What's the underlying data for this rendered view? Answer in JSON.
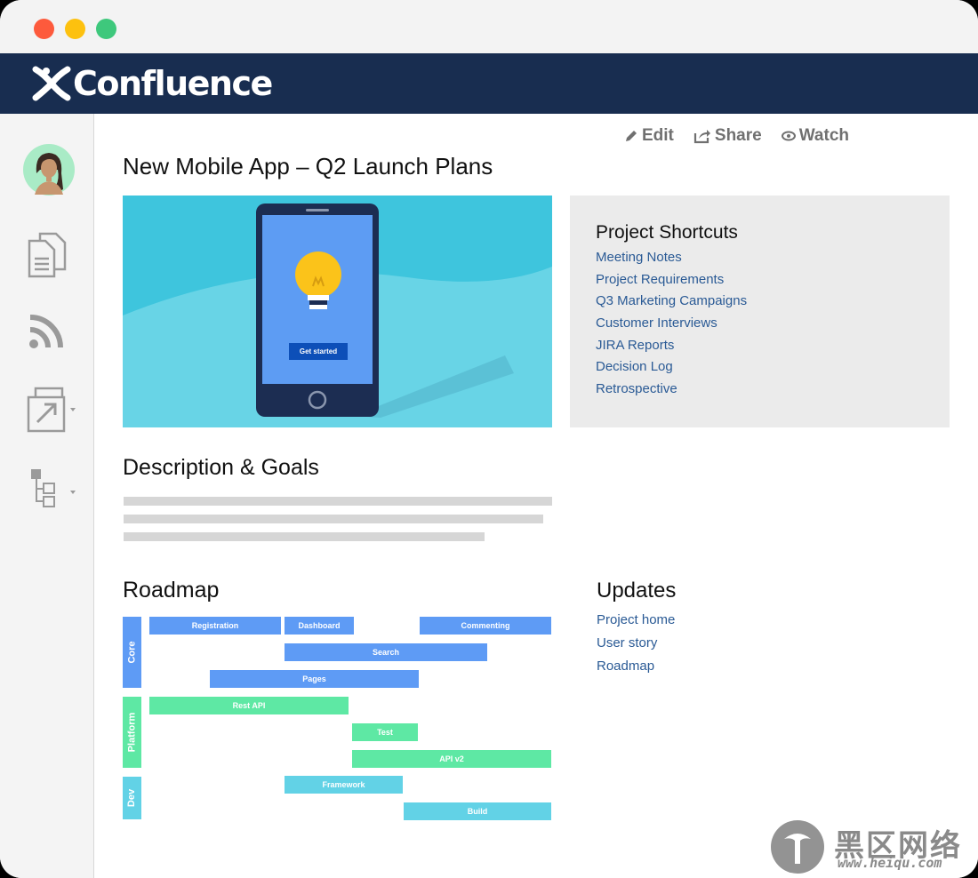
{
  "window": {
    "controls": [
      "close",
      "minimize",
      "maximize"
    ],
    "colors": {
      "close": "#fd5a3c",
      "minimize": "#fdc10f",
      "maximize": "#3ec87c"
    }
  },
  "header": {
    "app_name": "Confluence",
    "brand_color": "#182d50"
  },
  "sidebar": {
    "items": [
      {
        "name": "avatar",
        "icon": "user-avatar-icon"
      },
      {
        "name": "pages",
        "icon": "document-icon"
      },
      {
        "name": "feed",
        "icon": "rss-icon"
      },
      {
        "name": "shared",
        "icon": "share-link-icon"
      },
      {
        "name": "tree",
        "icon": "page-tree-icon"
      }
    ]
  },
  "toolbar": {
    "edit_label": "Edit",
    "share_label": "Share",
    "watch_label": "Watch"
  },
  "page": {
    "title": "New Mobile App – Q2 Launch Plans",
    "hero": {
      "button_label": "Get started"
    },
    "description_heading": "Description & Goals",
    "roadmap_heading": "Roadmap",
    "updates_heading": "Updates"
  },
  "shortcuts": {
    "heading": "Project Shortcuts",
    "links": [
      "Meeting Notes",
      "Project Requirements",
      "Q3 Marketing Campaigns",
      "Customer Interviews",
      "JIRA Reports",
      "Decision Log",
      "Retrospective"
    ]
  },
  "updates": {
    "links": [
      "Project home",
      "User story",
      "Roadmap"
    ]
  },
  "roadmap": {
    "lanes": [
      "Core",
      "Platform",
      "Dev"
    ],
    "bars": {
      "registration": "Registration",
      "dashboard": "Dashboard",
      "commenting": "Commenting",
      "search": "Search",
      "pages": "Pages",
      "rest_api": "Rest API",
      "test": "Test",
      "api_v2": "API v2",
      "framework": "Framework",
      "build": "Build"
    },
    "colors": {
      "core": "#5e9bf5",
      "platform": "#5ee8a4",
      "dev": "#62d2e6"
    }
  },
  "watermark": {
    "text": "黑区网络",
    "url": "www.heiqu.com"
  }
}
